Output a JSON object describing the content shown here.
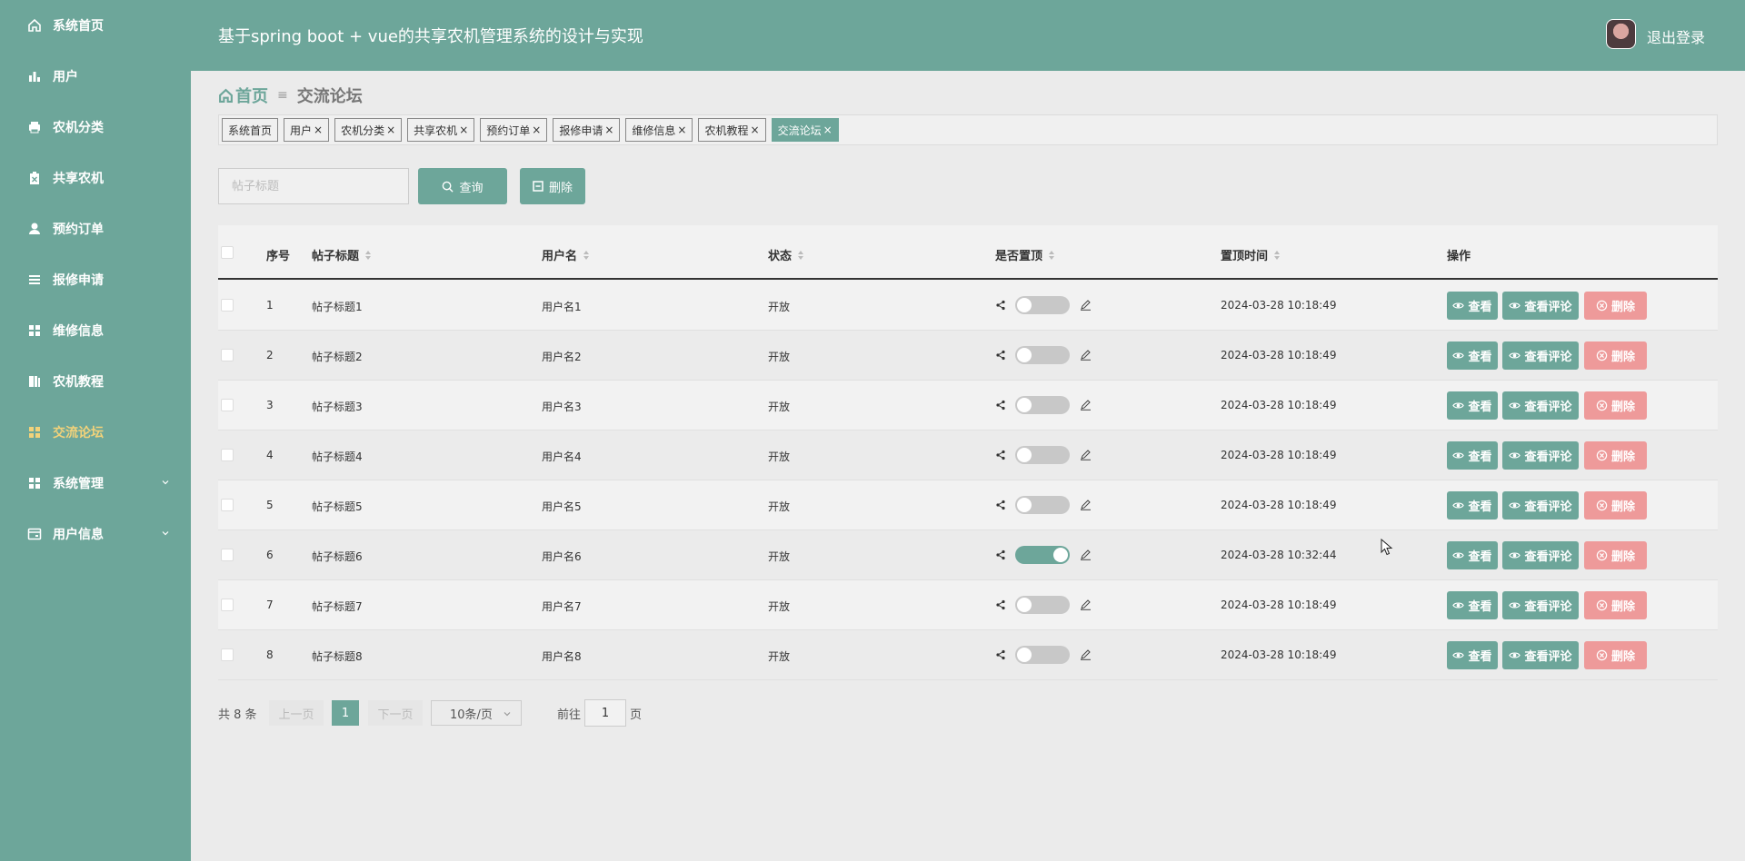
{
  "header": {
    "title": "基于spring boot + vue的共享农机管理系统的设计与实现",
    "logout": "退出登录"
  },
  "sidebar": {
    "items": [
      {
        "label": "系统首页",
        "icon": "home-icon"
      },
      {
        "label": "用户",
        "icon": "bar-chart-icon"
      },
      {
        "label": "农机分类",
        "icon": "printer-icon"
      },
      {
        "label": "共享农机",
        "icon": "clipboard-icon"
      },
      {
        "label": "预约订单",
        "icon": "user-icon"
      },
      {
        "label": "报修申请",
        "icon": "list-icon"
      },
      {
        "label": "维修信息",
        "icon": "grid-icon"
      },
      {
        "label": "农机教程",
        "icon": "book-icon"
      },
      {
        "label": "交流论坛",
        "icon": "grid-icon",
        "active": true
      },
      {
        "label": "系统管理",
        "icon": "grid-icon",
        "expandable": true
      },
      {
        "label": "用户信息",
        "icon": "card-icon",
        "expandable": true
      }
    ]
  },
  "breadcrumb": {
    "home": "首页",
    "current": "交流论坛"
  },
  "tags": [
    {
      "label": "系统首页",
      "closable": false
    },
    {
      "label": "用户",
      "closable": true
    },
    {
      "label": "农机分类",
      "closable": true
    },
    {
      "label": "共享农机",
      "closable": true
    },
    {
      "label": "预约订单",
      "closable": true
    },
    {
      "label": "报修申请",
      "closable": true
    },
    {
      "label": "维修信息",
      "closable": true
    },
    {
      "label": "农机教程",
      "closable": true
    },
    {
      "label": "交流论坛",
      "closable": true,
      "active": true
    }
  ],
  "search": {
    "placeholder": "帖子标题",
    "value": "",
    "query_label": "查询",
    "delete_label": "删除"
  },
  "table": {
    "columns": [
      "序号",
      "帖子标题",
      "用户名",
      "状态",
      "是否置顶",
      "置顶时间",
      "操作"
    ],
    "rows": [
      {
        "index": "1",
        "title": "帖子标题1",
        "username": "用户名1",
        "status": "开放",
        "pinned": false,
        "pin_time": "2024-03-28 10:18:49"
      },
      {
        "index": "2",
        "title": "帖子标题2",
        "username": "用户名2",
        "status": "开放",
        "pinned": false,
        "pin_time": "2024-03-28 10:18:49"
      },
      {
        "index": "3",
        "title": "帖子标题3",
        "username": "用户名3",
        "status": "开放",
        "pinned": false,
        "pin_time": "2024-03-28 10:18:49"
      },
      {
        "index": "4",
        "title": "帖子标题4",
        "username": "用户名4",
        "status": "开放",
        "pinned": false,
        "pin_time": "2024-03-28 10:18:49"
      },
      {
        "index": "5",
        "title": "帖子标题5",
        "username": "用户名5",
        "status": "开放",
        "pinned": false,
        "pin_time": "2024-03-28 10:18:49"
      },
      {
        "index": "6",
        "title": "帖子标题6",
        "username": "用户名6",
        "status": "开放",
        "pinned": true,
        "pin_time": "2024-03-28 10:32:44"
      },
      {
        "index": "7",
        "title": "帖子标题7",
        "username": "用户名7",
        "status": "开放",
        "pinned": false,
        "pin_time": "2024-03-28 10:18:49"
      },
      {
        "index": "8",
        "title": "帖子标题8",
        "username": "用户名8",
        "status": "开放",
        "pinned": false,
        "pin_time": "2024-03-28 10:18:49"
      }
    ],
    "actions": {
      "view": "查看",
      "comments": "查看评论",
      "delete": "删除"
    }
  },
  "pagination": {
    "total": "共 8 条",
    "prev": "上一页",
    "page": "1",
    "next": "下一页",
    "page_size": "10条/页",
    "goto": "前往",
    "goto_value": "1",
    "unit": "页"
  },
  "colors": {
    "primary": "#6da69a",
    "danger": "#ee9a9a",
    "active_nav": "#f2d27a"
  }
}
